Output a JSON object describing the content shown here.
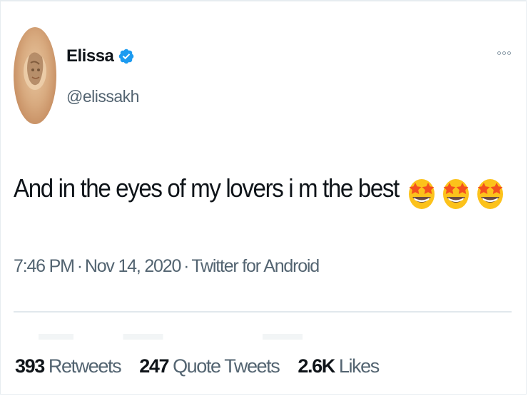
{
  "tweet": {
    "author": {
      "display_name": "Elissa",
      "handle": "@elissakh",
      "verified": true,
      "verified_color": "#1d9bf0"
    },
    "text": "And in the eyes of my lovers i m the best",
    "emojis": [
      "star-struck-emoji",
      "star-struck-emoji",
      "star-struck-emoji"
    ],
    "timestamp_time": "7:46 PM",
    "timestamp_date": "Nov 14, 2020",
    "separator": "·",
    "source": "Twitter for Android",
    "stats": {
      "retweets": {
        "count": "393",
        "label": "Retweets"
      },
      "quote_tweets": {
        "count": "247",
        "label": "Quote Tweets"
      },
      "likes": {
        "count": "2.6K",
        "label": "Likes"
      }
    },
    "menu_icon": "more-options-icon"
  }
}
